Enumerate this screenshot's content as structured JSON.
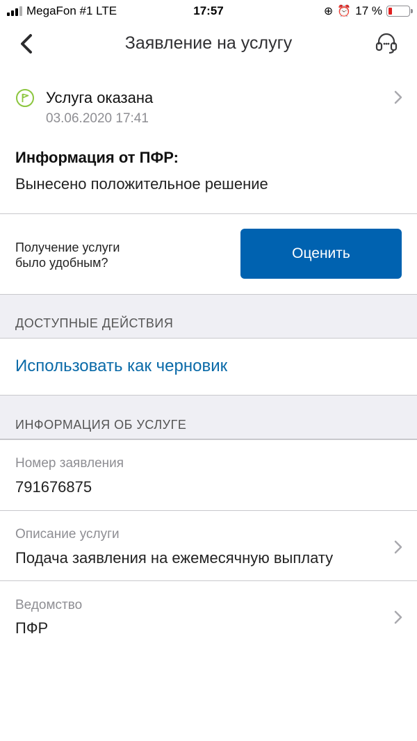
{
  "status_bar": {
    "carrier": "MegaFon #1  LTE",
    "time": "17:57",
    "battery": "17 %",
    "battery_level": 0.17
  },
  "nav": {
    "title": "Заявление на услугу"
  },
  "service_status": {
    "title": "Услуга оказана",
    "date": "03.06.2020 17:41"
  },
  "pfr_info": {
    "label": "Информация от ПФР:",
    "text": "Вынесено положительное решение"
  },
  "rating": {
    "question_line1": "Получение услуги",
    "question_line2": "было удобным?",
    "button_label": "Оценить"
  },
  "actions": {
    "header": "ДОСТУПНЫЕ ДЕЙСТВИЯ",
    "use_as_draft": "Использовать как черновик"
  },
  "service_info": {
    "header": "ИНФОРМАЦИЯ ОБ УСЛУГЕ",
    "rows": [
      {
        "key": "Номер заявления",
        "value": "791676875"
      },
      {
        "key": "Описание услуги",
        "value": "Подача заявления на ежемесячную выплату"
      },
      {
        "key": "Ведомство",
        "value": "ПФР"
      }
    ]
  },
  "colors": {
    "primary_button": "#0062b0",
    "link": "#0a6aa8",
    "status_green": "#8cc63f",
    "section_bg": "#efeff4"
  }
}
